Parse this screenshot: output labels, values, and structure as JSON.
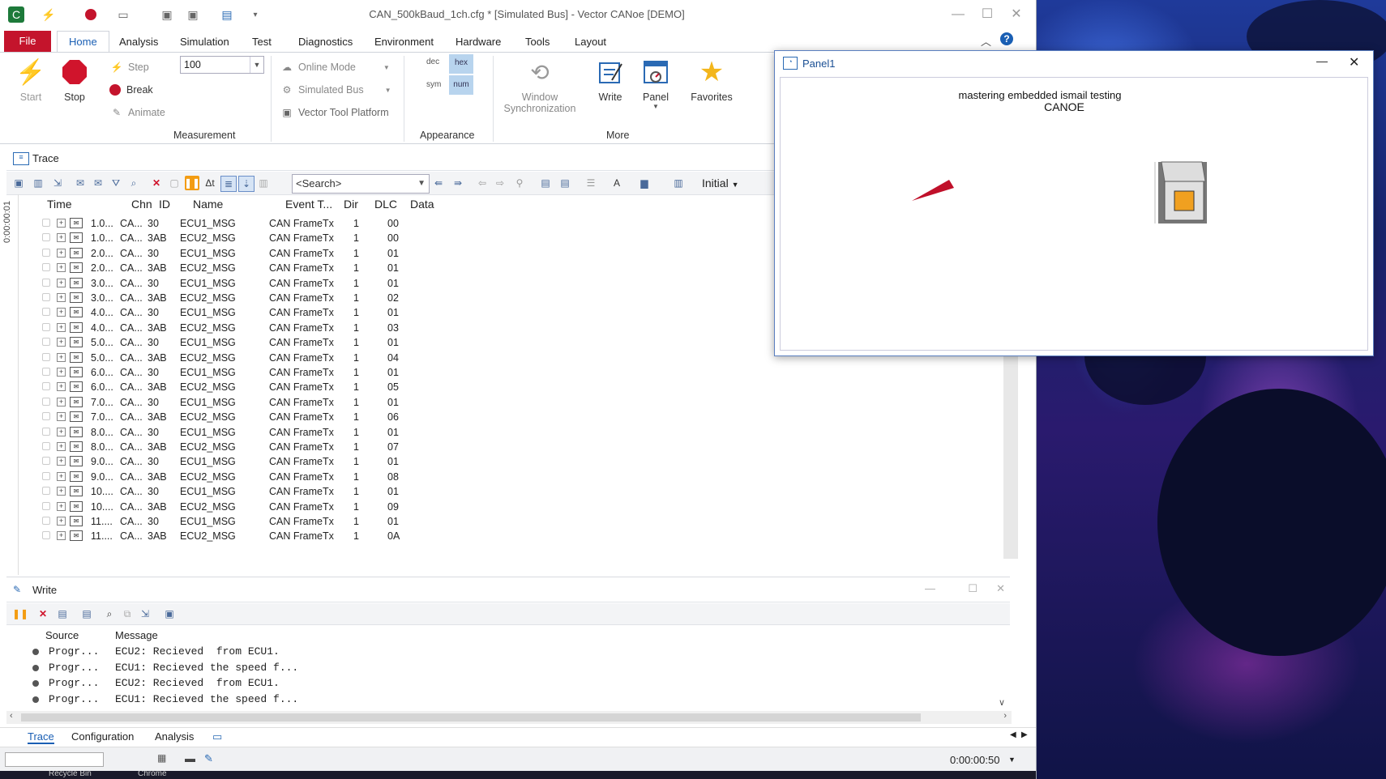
{
  "window": {
    "title": "CAN_500kBaud_1ch.cfg * [Simulated Bus] - Vector CANoe [DEMO]"
  },
  "ribbon": {
    "tabs": [
      "File",
      "Home",
      "Analysis",
      "Simulation",
      "Test",
      "Diagnostics",
      "Environment",
      "Hardware",
      "Tools",
      "Layout"
    ],
    "measurement": {
      "start": "Start",
      "stop": "Stop",
      "step": "Step",
      "break": "Break",
      "animate": "Animate",
      "speed_value": "100",
      "label": "Measurement"
    },
    "mode": {
      "online_mode": "Online Mode",
      "simulated_bus": "Simulated Bus",
      "vector_tool_platform": "Vector Tool Platform"
    },
    "appearance": {
      "dec": "dec",
      "hex": "hex",
      "sym": "sym",
      "num": "num",
      "label": "Appearance"
    },
    "more": {
      "window_sync_line1": "Window",
      "window_sync_line2": "Synchronization",
      "write": "Write",
      "panel": "Panel",
      "favorites": "Favorites",
      "label": "More"
    }
  },
  "trace": {
    "title": "Trace",
    "search_placeholder": "<Search>",
    "view_preset": "Initial",
    "time_ruler": "0:00:00:01",
    "columns": [
      "Time",
      "Chn",
      "ID",
      "Name",
      "Event T...",
      "Dir",
      "DLC",
      "Data"
    ],
    "rows": [
      [
        "1.0...",
        "CA...",
        "30",
        "ECU1_MSG",
        "CAN Frame",
        "Tx",
        "1",
        "00"
      ],
      [
        "1.0...",
        "CA...",
        "3AB",
        "ECU2_MSG",
        "CAN Frame",
        "Tx",
        "1",
        "00"
      ],
      [
        "2.0...",
        "CA...",
        "30",
        "ECU1_MSG",
        "CAN Frame",
        "Tx",
        "1",
        "01"
      ],
      [
        "2.0...",
        "CA...",
        "3AB",
        "ECU2_MSG",
        "CAN Frame",
        "Tx",
        "1",
        "01"
      ],
      [
        "3.0...",
        "CA...",
        "30",
        "ECU1_MSG",
        "CAN Frame",
        "Tx",
        "1",
        "01"
      ],
      [
        "3.0...",
        "CA...",
        "3AB",
        "ECU2_MSG",
        "CAN Frame",
        "Tx",
        "1",
        "02"
      ],
      [
        "4.0...",
        "CA...",
        "30",
        "ECU1_MSG",
        "CAN Frame",
        "Tx",
        "1",
        "01"
      ],
      [
        "4.0...",
        "CA...",
        "3AB",
        "ECU2_MSG",
        "CAN Frame",
        "Tx",
        "1",
        "03"
      ],
      [
        "5.0...",
        "CA...",
        "30",
        "ECU1_MSG",
        "CAN Frame",
        "Tx",
        "1",
        "01"
      ],
      [
        "5.0...",
        "CA...",
        "3AB",
        "ECU2_MSG",
        "CAN Frame",
        "Tx",
        "1",
        "04"
      ],
      [
        "6.0...",
        "CA...",
        "30",
        "ECU1_MSG",
        "CAN Frame",
        "Tx",
        "1",
        "01"
      ],
      [
        "6.0...",
        "CA...",
        "3AB",
        "ECU2_MSG",
        "CAN Frame",
        "Tx",
        "1",
        "05"
      ],
      [
        "7.0...",
        "CA...",
        "30",
        "ECU1_MSG",
        "CAN Frame",
        "Tx",
        "1",
        "01"
      ],
      [
        "7.0...",
        "CA...",
        "3AB",
        "ECU2_MSG",
        "CAN Frame",
        "Tx",
        "1",
        "06"
      ],
      [
        "8.0...",
        "CA...",
        "30",
        "ECU1_MSG",
        "CAN Frame",
        "Tx",
        "1",
        "01"
      ],
      [
        "8.0...",
        "CA...",
        "3AB",
        "ECU2_MSG",
        "CAN Frame",
        "Tx",
        "1",
        "07"
      ],
      [
        "9.0...",
        "CA...",
        "30",
        "ECU1_MSG",
        "CAN Frame",
        "Tx",
        "1",
        "01"
      ],
      [
        "9.0...",
        "CA...",
        "3AB",
        "ECU2_MSG",
        "CAN Frame",
        "Tx",
        "1",
        "08"
      ],
      [
        "10....",
        "CA...",
        "30",
        "ECU1_MSG",
        "CAN Frame",
        "Tx",
        "1",
        "01"
      ],
      [
        "10....",
        "CA...",
        "3AB",
        "ECU2_MSG",
        "CAN Frame",
        "Tx",
        "1",
        "09"
      ],
      [
        "11....",
        "CA...",
        "30",
        "ECU1_MSG",
        "CAN Frame",
        "Tx",
        "1",
        "01"
      ],
      [
        "11....",
        "CA...",
        "3AB",
        "ECU2_MSG",
        "CAN Frame",
        "Tx",
        "1",
        "0A"
      ]
    ]
  },
  "write": {
    "title": "Write",
    "columns": [
      "Source",
      "Message"
    ],
    "rows": [
      [
        "Progr...",
        "ECU2: Recieved  from ECU1."
      ],
      [
        "Progr...",
        "ECU1: Recieved the speed f..."
      ],
      [
        "Progr...",
        "ECU2: Recieved  from ECU1."
      ],
      [
        "Progr...",
        "ECU1: Recieved the speed f..."
      ]
    ]
  },
  "bottom_tabs": [
    "Trace",
    "Configuration",
    "Analysis"
  ],
  "status": {
    "clock": "0:00:00:50"
  },
  "taskbar": {
    "items": [
      "Recycle Bin",
      "Chrome"
    ]
  },
  "panel": {
    "title": "Panel1",
    "text_line1": "mastering embedded ismail testing",
    "text_line2": "CANOE"
  },
  "colors": {
    "file_tab": "#c4142c",
    "accent_blue": "#1a5fb4",
    "stop_red": "#d0142c",
    "hex_highlight": "#b8d4ee",
    "switch_orange": "#f0a020",
    "pointer_red": "#c0102a"
  }
}
